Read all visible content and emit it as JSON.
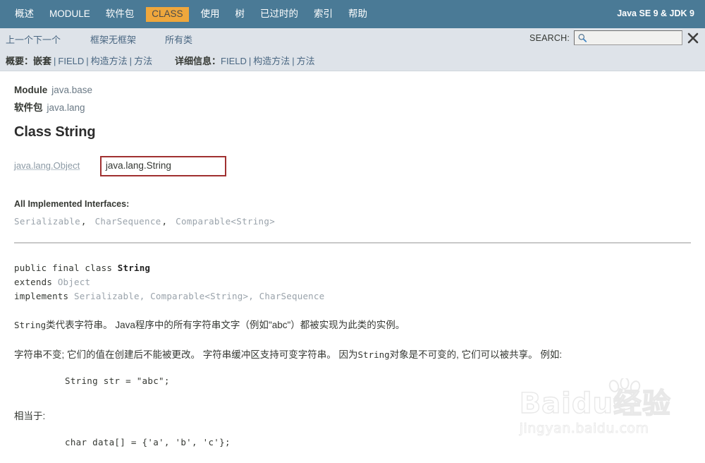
{
  "topnav": {
    "items": [
      {
        "label": "概述",
        "active": false
      },
      {
        "label": "MODULE",
        "active": false
      },
      {
        "label": "软件包",
        "active": false
      },
      {
        "label": "CLASS",
        "active": true
      },
      {
        "label": "使用",
        "active": false
      },
      {
        "label": "树",
        "active": false
      },
      {
        "label": "已过时的",
        "active": false
      },
      {
        "label": "索引",
        "active": false
      },
      {
        "label": "帮助",
        "active": false
      }
    ],
    "version": "Java SE 9 & JDK 9",
    "active_color": "#efa73c",
    "bar_color": "#4a7a96"
  },
  "subnav": {
    "prev": "上一个",
    "next": "下一个",
    "frames": "框架",
    "no_frames": "无框架",
    "all_classes": "所有类",
    "search": {
      "label": "SEARCH:",
      "value": "",
      "placeholder": "",
      "icon": "search-icon",
      "reset_icon": "close-icon"
    },
    "summary": {
      "title": "概要：",
      "items": [
        "嵌套",
        "FIELD",
        "构造方法",
        "方法"
      ]
    },
    "detail": {
      "title": "详细信息：",
      "items": [
        "FIELD",
        "构造方法",
        "方法"
      ]
    }
  },
  "content": {
    "module_label": "Module",
    "module_value": "java.base",
    "package_label": "软件包",
    "package_value": "java.lang",
    "class_title": "Class String",
    "inheritance": {
      "parent": "java.lang.Object",
      "current": "java.lang.String",
      "highlight_color": "#a03030"
    },
    "interfaces_heading": "All Implemented Interfaces:",
    "interfaces": [
      "Serializable",
      "CharSequence",
      "Comparable<String>"
    ],
    "declaration": {
      "line1_prefix": "public final class ",
      "line1_name": "String",
      "line2_kw": "extends ",
      "line2_ref": "Object",
      "line3_kw": "implements ",
      "line3_ref": "Serializable, Comparable<String>, CharSequence"
    },
    "paragraph1_mono": "String",
    "paragraph1_rest": "类代表字符串。 Java程序中的所有字符串文字（例如\"abc\"）都被实现为此类的实例。",
    "paragraph2_a": "字符串不变; 它们的值在创建后不能被更改。 字符串缓冲区支持可变字符串。 因为",
    "paragraph2_mono": "String",
    "paragraph2_b": "对象是不可变的, 它们可以被共享。 例如:",
    "code1": "String str = \"abc\";",
    "paragraph3": "相当于:",
    "code2": "char data[] = {'a', 'b', 'c'};"
  },
  "watermark": {
    "main": "Baidu经验",
    "sub": "jingyan.baidu.com"
  }
}
